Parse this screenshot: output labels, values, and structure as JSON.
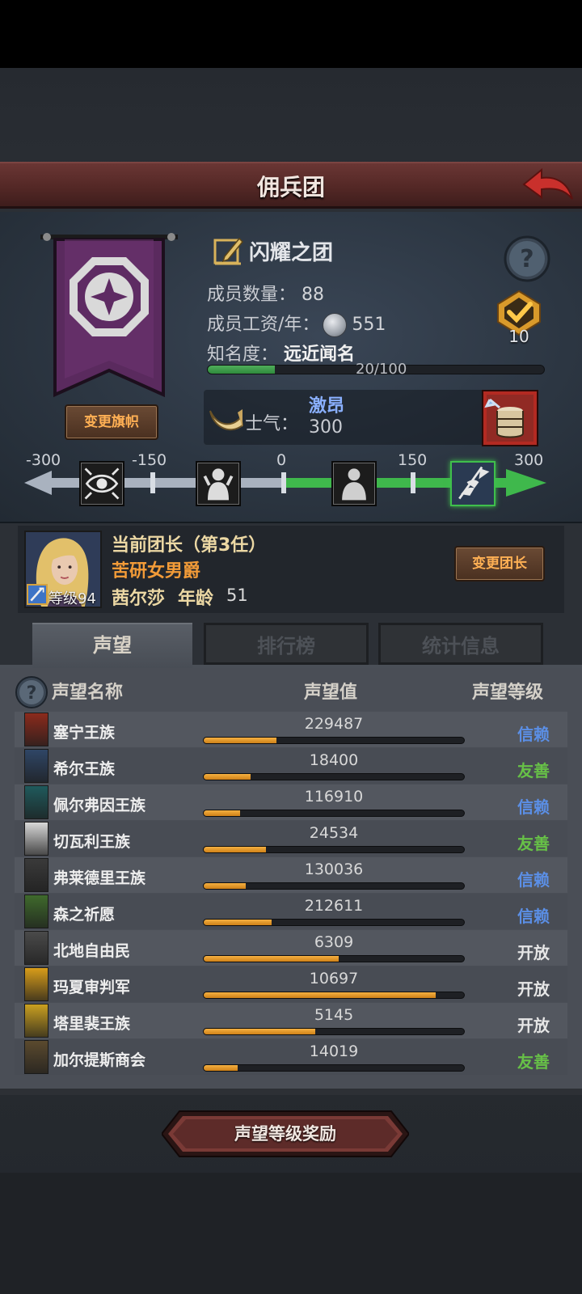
{
  "header": {
    "title": "佣兵团"
  },
  "troop": {
    "name": "闪耀之团",
    "members_label": "成员数量：",
    "members": "88",
    "salary_label": "成员工资/年：",
    "salary": "551",
    "fame_label": "知名度：",
    "fame_value": "远近闻名",
    "fame_progress_text": "20/100",
    "fame_progress": 0.2,
    "medal_count": "10",
    "change_flag_label": "变更旗帜"
  },
  "morale": {
    "label": "士气：",
    "state": "激昂",
    "value": "300",
    "scale": [
      "-300",
      "-150",
      "0",
      "150",
      "300"
    ],
    "active_stage": 4
  },
  "leader": {
    "title": "当前团长（第3任）",
    "rank": "苦研女男爵",
    "name": "茜尔莎",
    "age_label": "年龄",
    "age": "51",
    "level": "等级94",
    "change_label": "变更团长"
  },
  "tabs": [
    "声望",
    "排行榜",
    "统计信息"
  ],
  "list": {
    "col_name": "声望名称",
    "col_value": "声望值",
    "col_level": "声望等级",
    "rows": [
      {
        "name": "塞宁王族",
        "value": "229487",
        "fill": 0.28,
        "level": "信赖",
        "level_color": "#5b8fe6",
        "icon_color": "#8b2a1c"
      },
      {
        "name": "希尔王族",
        "value": "18400",
        "fill": 0.18,
        "level": "友善",
        "level_color": "#67c147",
        "icon_color": "#2f4666"
      },
      {
        "name": "佩尔弗因王族",
        "value": "116910",
        "fill": 0.14,
        "level": "信赖",
        "level_color": "#5b8fe6",
        "icon_color": "#1f5a5c"
      },
      {
        "name": "切瓦利王族",
        "value": "24534",
        "fill": 0.24,
        "level": "友善",
        "level_color": "#67c147",
        "icon_color": "#d8d8d8"
      },
      {
        "name": "弗莱德里王族",
        "value": "130036",
        "fill": 0.16,
        "level": "信赖",
        "level_color": "#5b8fe6",
        "icon_color": "#3a3a3a"
      },
      {
        "name": "森之祈愿",
        "value": "212611",
        "fill": 0.26,
        "level": "信赖",
        "level_color": "#5b8fe6",
        "icon_color": "#3f6a2c"
      },
      {
        "name": "北地自由民",
        "value": "6309",
        "fill": 0.52,
        "level": "开放",
        "level_color": "#e6e6e6",
        "icon_color": "#4a4a4a"
      },
      {
        "name": "玛夏审判军",
        "value": "10697",
        "fill": 0.89,
        "level": "开放",
        "level_color": "#e6e6e6",
        "icon_color": "#d89d1a"
      },
      {
        "name": "塔里裴王族",
        "value": "5145",
        "fill": 0.43,
        "level": "开放",
        "level_color": "#e6e6e6",
        "icon_color": "#caa020"
      },
      {
        "name": "加尔提斯商会",
        "value": "14019",
        "fill": 0.13,
        "level": "友善",
        "level_color": "#67c147",
        "icon_color": "#5b4a2e"
      }
    ]
  },
  "reward_button": "声望等级奖励"
}
